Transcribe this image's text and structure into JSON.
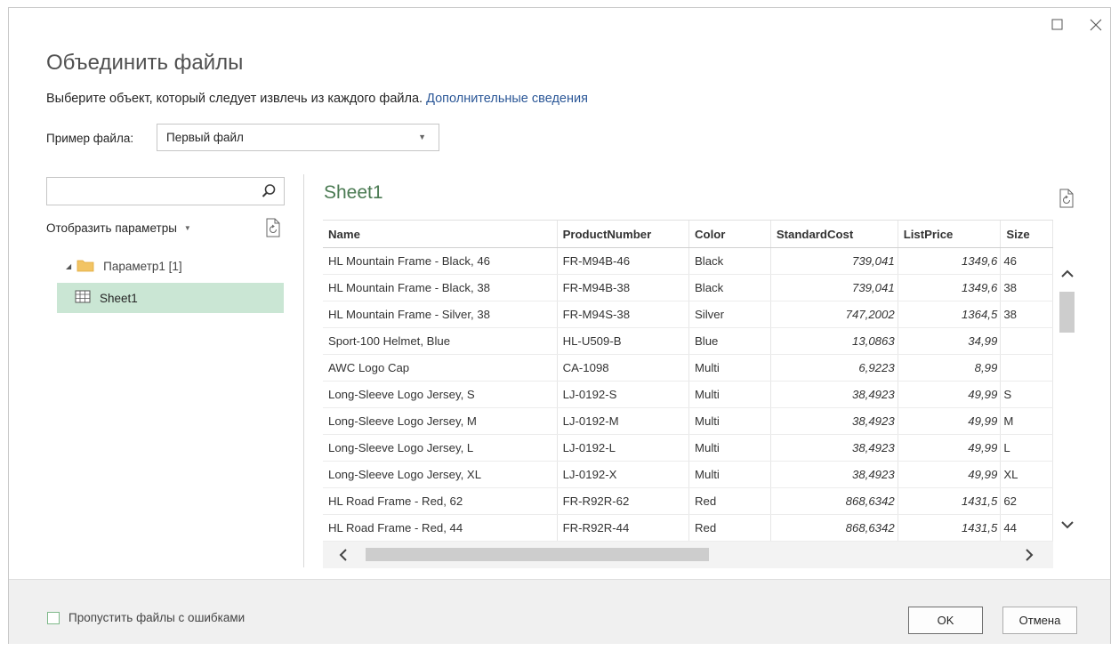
{
  "dialog": {
    "title": "Объединить файлы",
    "subtitle": "Выберите объект, который следует извлечь из каждого файла.",
    "learn_more": "Дополнительные сведения",
    "sample_label": "Пример файла:",
    "sample_value": "Первый файл"
  },
  "navigator": {
    "search_placeholder": "",
    "options_label": "Отобразить параметры",
    "folder_label": "Параметр1 [1]",
    "sheet_label": "Sheet1"
  },
  "preview": {
    "title": "Sheet1",
    "columns": [
      "Name",
      "ProductNumber",
      "Color",
      "StandardCost",
      "ListPrice",
      "Size"
    ],
    "rows": [
      [
        "HL Mountain Frame - Black, 46",
        "FR-M94B-46",
        "Black",
        "739,041",
        "1349,6",
        "46"
      ],
      [
        "HL Mountain Frame - Black, 38",
        "FR-M94B-38",
        "Black",
        "739,041",
        "1349,6",
        "38"
      ],
      [
        "HL Mountain Frame - Silver, 38",
        "FR-M94S-38",
        "Silver",
        "747,2002",
        "1364,5",
        "38"
      ],
      [
        "Sport-100 Helmet, Blue",
        "HL-U509-B",
        "Blue",
        "13,0863",
        "34,99",
        ""
      ],
      [
        "AWC Logo Cap",
        "CA-1098",
        "Multi",
        "6,9223",
        "8,99",
        ""
      ],
      [
        "Long-Sleeve Logo Jersey, S",
        "LJ-0192-S",
        "Multi",
        "38,4923",
        "49,99",
        "S"
      ],
      [
        "Long-Sleeve Logo Jersey, M",
        "LJ-0192-M",
        "Multi",
        "38,4923",
        "49,99",
        "M"
      ],
      [
        "Long-Sleeve Logo Jersey, L",
        "LJ-0192-L",
        "Multi",
        "38,4923",
        "49,99",
        "L"
      ],
      [
        "Long-Sleeve Logo Jersey, XL",
        "LJ-0192-X",
        "Multi",
        "38,4923",
        "49,99",
        "XL"
      ],
      [
        "HL Road Frame - Red, 62",
        "FR-R92R-62",
        "Red",
        "868,6342",
        "1431,5",
        "62"
      ],
      [
        "HL Road Frame - Red, 44",
        "FR-R92R-44",
        "Red",
        "868,6342",
        "1431,5",
        "44"
      ],
      [
        "",
        "",
        "",
        "",
        "",
        ""
      ]
    ]
  },
  "footer": {
    "skip_errors_label": "Пропустить файлы с ошибками",
    "skip_errors_checked": false,
    "ok_label": "OK",
    "cancel_label": "Отмена"
  },
  "colors": {
    "selection": "#cae6d4",
    "link": "#2b5797",
    "preview_title": "#4a7a52"
  }
}
